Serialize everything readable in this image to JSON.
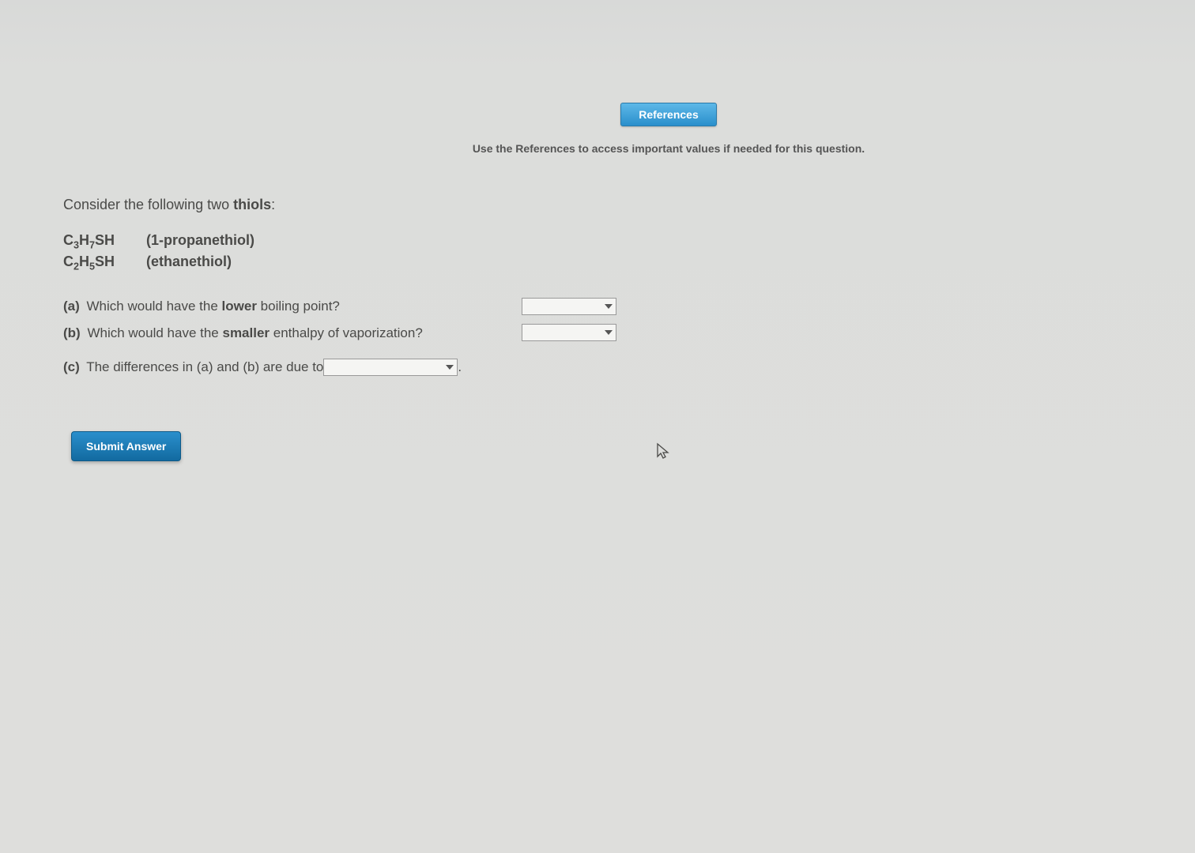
{
  "header": {
    "references_button": "References",
    "hint": "Use the References to access important values if needed for this question."
  },
  "question": {
    "intro_prefix": "Consider the following two ",
    "intro_bold": "thiols",
    "intro_suffix": ":",
    "compounds": [
      {
        "formula_c": "C",
        "formula_n1": "3",
        "formula_h": "H",
        "formula_n2": "7",
        "formula_sh": "SH",
        "name": "(1-propanethiol)"
      },
      {
        "formula_c": "C",
        "formula_n1": "2",
        "formula_h": "H",
        "formula_n2": "5",
        "formula_sh": "SH",
        "name": "(ethanethiol)"
      }
    ],
    "parts": {
      "a": {
        "label": "(a)",
        "text_before": " Which would have the ",
        "bold": "lower",
        "text_after": " boiling point?"
      },
      "b": {
        "label": "(b)",
        "text_before": " Which would have the ",
        "bold": "smaller",
        "text_after": " enthalpy of vaporization?"
      },
      "c": {
        "label": "(c)",
        "text_before": " The differences in (a) and (b) are due to ",
        "text_after": "."
      }
    }
  },
  "submit_label": "Submit Answer"
}
